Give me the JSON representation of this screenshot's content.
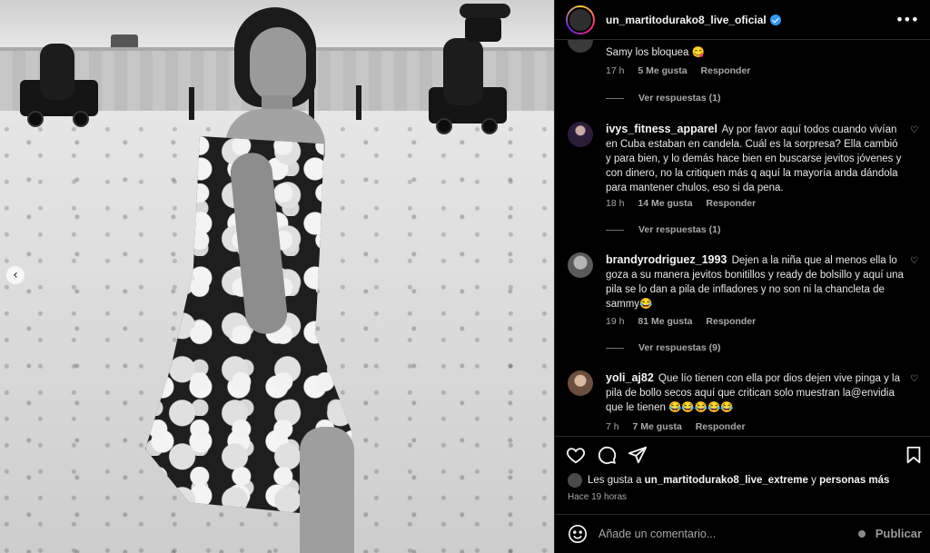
{
  "post": {
    "username": "un_martitodurako8_live_oficial",
    "verified": true
  },
  "comments": [
    {
      "author": "",
      "text": "Samy los bloquea 😋",
      "time": "17 h",
      "likes": "5 Me gusta",
      "reply": "Responder",
      "view_replies": "Ver respuestas (1)"
    },
    {
      "author": "ivys_fitness_apparel",
      "text": "Ay por favor aquí todos cuando vivían en Cuba estaban en candela. Cuál es la sorpresa? Ella cambió y para bien, y lo demás hace bien en buscarse jevitos jóvenes y con dinero, no la critiquen más q aquí la mayoría anda dándola para mantener chulos, eso si da pena.",
      "time": "18 h",
      "likes": "14 Me gusta",
      "reply": "Responder",
      "view_replies": "Ver respuestas (1)"
    },
    {
      "author": "brandyrodriguez_1993",
      "text": "Dejen a la niña que al menos ella lo goza a su manera jevitos bonitillos y ready de bolsillo y aquí una pila se lo dan a pila de infladores y no son ni la chancleta de sammy😂",
      "time": "19 h",
      "likes": "81 Me gusta",
      "reply": "Responder",
      "view_replies": "Ver respuestas (9)"
    },
    {
      "author": "yoli_aj82",
      "text": "Que lío tienen con ella por dios dejen vive pinga y la pila de bollo secos aquí que critican solo muestran la@envidia que le tienen 😂😂😂😂😂",
      "time": "7 h",
      "likes": "7 Me gusta",
      "reply": "Responder",
      "view_replies": ""
    }
  ],
  "likes_line": {
    "prefix": "Les gusta a",
    "user": "un_martitodurako8_live_extreme",
    "middle": "y",
    "others": "personas más"
  },
  "time_ago": "Hace 19 horas",
  "add_comment": {
    "placeholder": "Añade un comentario...",
    "publish": "Publicar"
  },
  "icons": {
    "more": "more-icon",
    "heart": "heart-icon",
    "comment": "comment-icon",
    "share": "share-icon",
    "bookmark": "bookmark-icon",
    "emoji": "emoji-icon",
    "verified": "verified-badge-icon",
    "slider_prev": "chevron-left-icon"
  },
  "colors": {
    "background": "#000000",
    "verified": "#3897f0",
    "secondary_text": "#a8a8a8"
  }
}
